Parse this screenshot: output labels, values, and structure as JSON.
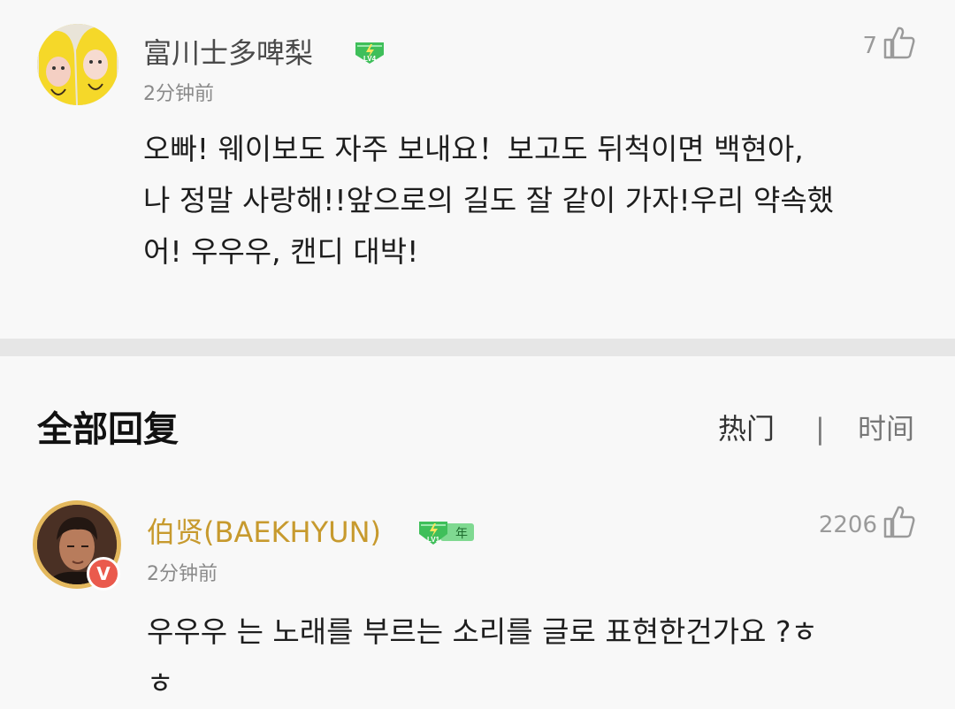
{
  "top_comment": {
    "username": "富川士多啤梨",
    "level_badge": "LV4",
    "time": "2分钟前",
    "likes": "7",
    "lines": [
      "오빠! 웨이보도 자주 보내요！보고도 뒤척이면 백현아,",
      "나 정말 사랑해!!앞으로의 길도 잘 같이 가자!우리 약속했",
      "어! 우우우, 캔디 대박!"
    ]
  },
  "replies": {
    "title": "全部回复",
    "sort_hot": "热门",
    "sort_sep": "|",
    "sort_time": "时间"
  },
  "reply": {
    "username": "伯贤(BAEKHYUN)",
    "level_badge": "LV1",
    "year_badge": "年",
    "verified": "V",
    "time": "2分钟前",
    "likes": "2206",
    "lines": [
      "우우우 는 노래를 부르는 소리를 글로 표현한건가요 ?ㅎ",
      "ㅎ"
    ]
  },
  "colors": {
    "vip_gold": "#c79a2e",
    "badge_green": "#3fbf5a",
    "verified_red": "#ea5a4d"
  }
}
